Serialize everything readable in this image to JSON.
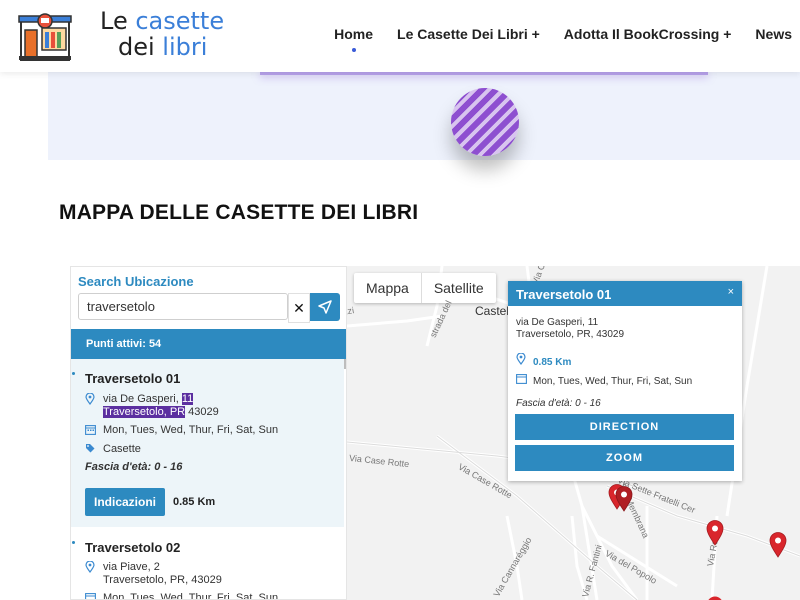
{
  "header": {
    "logo_line1_prefix": "Le ",
    "logo_line1_accent": "casette",
    "logo_line2_prefix": "dei ",
    "logo_line2_accent": "libri",
    "nav": [
      {
        "label": "Home"
      },
      {
        "label": "Le Casette Dei Libri +"
      },
      {
        "label": "Adotta Il BookCrossing +"
      },
      {
        "label": "News"
      }
    ]
  },
  "section": {
    "title": "MAPPA DELLE CASETTE DEI LIBRI"
  },
  "sidebar": {
    "search_label": "Search Ubicazione",
    "search_value": "traversetolo",
    "clear_glyph": "✕",
    "points_label": "Punti attivi: 54",
    "results": [
      {
        "title": "Traversetolo 01",
        "addr_line1_pre": "via De Gasperi, ",
        "addr_line1_hl": "11",
        "addr_line2_hl": "Traversetolo, PR",
        "addr_line2_post": " 43029",
        "days": "Mon, Tues, Wed, Thur, Fri, Sat, Sun",
        "category": "Casette",
        "age": "Fascia d'età: 0 - 16",
        "button": "Indicazioni",
        "distance": "0.85 Km"
      },
      {
        "title": "Traversetolo 02",
        "addr_line1": "via Piave, 2",
        "addr_line2": "Traversetolo, PR, 43029",
        "days": "Mon, Tues, Wed, Thur, Fri, Sat, Sun"
      }
    ]
  },
  "map": {
    "type_map": "Mappa",
    "type_satellite": "Satellite",
    "town": "Castel",
    "streets": {
      "case_rotte_1": "Via Case Rotte",
      "case_rotte_2": "Via Case Rotte",
      "sette_fratelli": "Via Sette Fratelli Cer",
      "popolo": "Via del Popolo",
      "fantini": "Via R. Fantini",
      "canareggio": "Via Cannaréggio",
      "strada_del": "strada del",
      "zzi": "zzi",
      "via_ci": "Via Ci",
      "via_ro": "Via Ro",
      "membrana": "Via Membrana"
    },
    "info": {
      "title": "Traversetolo 01",
      "close": "×",
      "addr_line1": "via De Gasperi, 11",
      "addr_line2": "Traversetolo, PR, 43029",
      "distance": "0.85 Km",
      "days": "Mon, Tues, Wed, Thur, Fri, Sat, Sun",
      "age": "Fascia d'età: 0 - 16",
      "direction_button": "DIRECTION",
      "zoom_button": "ZOOM"
    }
  },
  "colors": {
    "accent": "#2d8ac0",
    "pin": "#d9262c",
    "highlight": "#5b2fa0",
    "logo_blue": "#3b7fd8"
  },
  "icons": [
    "logo-house-icon",
    "location-pin-icon",
    "calendar-icon",
    "tag-icon",
    "navigate-arrow-icon",
    "close-icon",
    "map-marker-icon"
  ]
}
